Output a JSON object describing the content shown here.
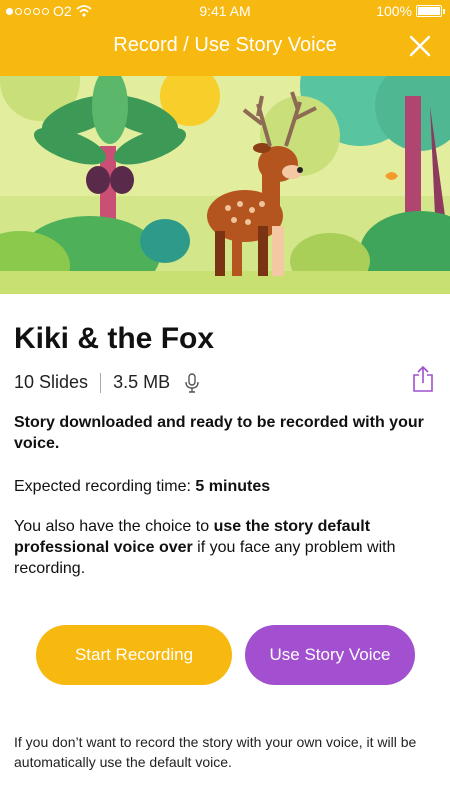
{
  "status_bar": {
    "carrier": "O2",
    "time": "9:41 AM",
    "battery": "100%"
  },
  "header": {
    "title": "Record / Use Story Voice",
    "close_icon": "close-icon"
  },
  "story": {
    "title": "Kiki & the Fox",
    "slides": "10 Slides",
    "size": "3.5 MB"
  },
  "body": {
    "ready": "Story downloaded and ready to be recorded with your voice.",
    "expected_label": "Expected recording time: ",
    "expected_value": "5 minutes",
    "choice_prefix": "You also have the choice to ",
    "choice_bold": "use the story default professional voice over",
    "choice_suffix": " if you face any problem with recording."
  },
  "actions": {
    "start_recording": "Start Recording",
    "use_story_voice": "Use Story Voice"
  },
  "footnote": "If you don’t want to record the story with your own voice, it will be automatically use the default voice.",
  "colors": {
    "accent": "#f7b80f",
    "purple": "#a24fd0"
  }
}
